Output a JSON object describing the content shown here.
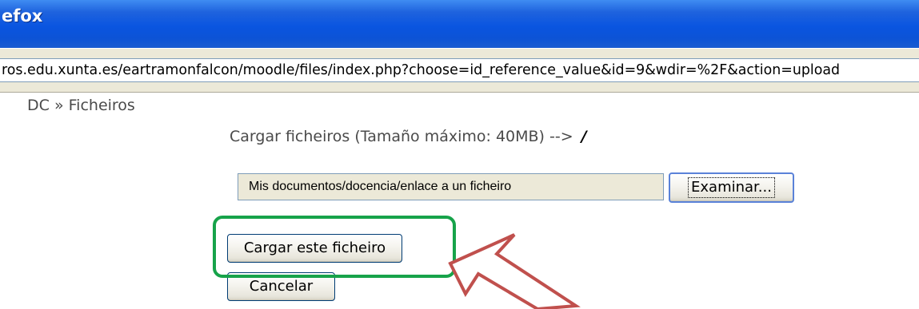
{
  "window": {
    "title": "efox"
  },
  "address_bar": {
    "url": "ros.edu.xunta.es/eartramonfalcon/moodle/files/index.php?choose=id_reference_value&id=9&wdir=%2F&action=upload"
  },
  "breadcrumb": {
    "root": "DC",
    "separator": "»",
    "current": "Ficheiros"
  },
  "upload": {
    "heading": "Cargar ficheiros (Tamaño máximo: 40MB) -->",
    "directory": "/",
    "file_path_value": "Mis documentos/docencia/enlace a un ficheiro",
    "browse_label": "Examinar...",
    "submit_label": "Cargar este ficheiro",
    "cancel_label": "Cancelar"
  },
  "annotations": {
    "highlight_color": "#17a34a",
    "arrow_color": "#c0504d",
    "arrow_icon": "hollow-arrow-pointing-up-left"
  },
  "colors": {
    "titlebar": "#0a55e0",
    "chrome": "#ece9d8"
  }
}
